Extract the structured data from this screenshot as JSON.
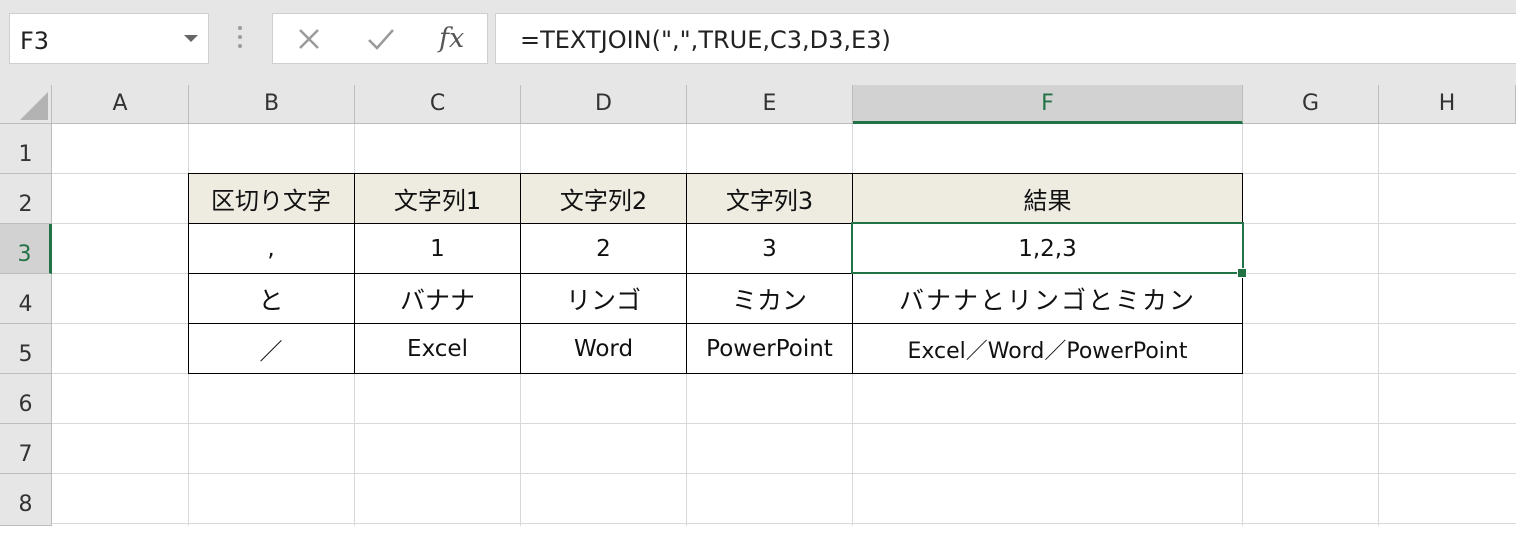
{
  "name_box": {
    "value": "F3"
  },
  "formula_bar": {
    "cancel_icon": "close-icon",
    "enter_icon": "checkmark-icon",
    "function_label": "fx",
    "formula": "=TEXTJOIN(\",\",TRUE,C3,D3,E3)"
  },
  "columns": [
    "A",
    "B",
    "C",
    "D",
    "E",
    "F",
    "G",
    "H"
  ],
  "selected_column": "F",
  "rows": [
    "1",
    "2",
    "3",
    "4",
    "5",
    "6",
    "7",
    "8"
  ],
  "selected_row": "3",
  "table": {
    "headers": [
      "区切り文字",
      "文字列1",
      "文字列2",
      "文字列3",
      "結果"
    ],
    "rows": [
      [
        ",",
        "1",
        "2",
        "3",
        "1,2,3"
      ],
      [
        "と",
        "バナナ",
        "リンゴ",
        "ミカン",
        "バナナとリンゴとミカン"
      ],
      [
        "／",
        "Excel",
        "Word",
        "PowerPoint",
        "Excel／Word／PowerPoint"
      ]
    ]
  },
  "colors": {
    "accent": "#217346",
    "header_fill": "#eeece1"
  }
}
